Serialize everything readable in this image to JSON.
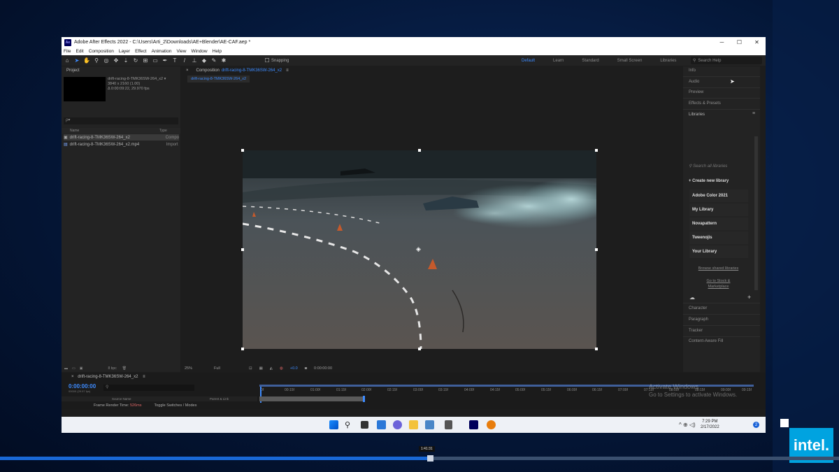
{
  "window": {
    "title": "Adobe After Effects 2022 - C:\\Users\\Arti_2\\Downloads\\AE+Blender\\AE-CAF.aep *",
    "app_abbr": "Ae"
  },
  "controls": {
    "minimize": "─",
    "maximize": "☐",
    "close": "✕"
  },
  "menu": [
    "File",
    "Edit",
    "Composition",
    "Layer",
    "Effect",
    "Animation",
    "View",
    "Window",
    "Help"
  ],
  "toolbar": {
    "snapping": "Snapping"
  },
  "workspaces": [
    "Default",
    "Learn",
    "Standard",
    "Small Screen",
    "Libraries"
  ],
  "search_help": "Search Help",
  "project": {
    "title": "Project",
    "item_name": "drift-racing-8-TMK36SW-264_x2 ▾",
    "item_res": "3840 x 2160 (1.00)",
    "item_dur": "Δ 0:00:09:22, 29.970 fps",
    "search_placeholder": "ρ▾",
    "col_name": "Name",
    "col_type": "Type",
    "rows": [
      {
        "name": "drift-racing-8-TMK36SW-264_x2",
        "type": "Compo"
      },
      {
        "name": "drift-racing-8-TMK36SW-264_x2.mp4",
        "type": "Import"
      }
    ],
    "bpc": "8 bpc"
  },
  "composition": {
    "label": "Composition",
    "name": "drift-racing-8-TMK36SW-264_x2",
    "subtab": "drift-racing-8-TMK36SW-264_x2",
    "zoom": "25%",
    "resolution": "Full",
    "exposure": "+0.0",
    "timecode": "0:00:00:00"
  },
  "right_panel": {
    "items_top": [
      "Info",
      "Audio",
      "Preview",
      "Effects & Presets",
      "Libraries"
    ],
    "library_search": "Search all libraries",
    "create_library": "+ Create new library",
    "libraries": [
      "Adobe Color 2021",
      "My Library",
      "Novapattern",
      "Tweenojis",
      "Your Library"
    ],
    "links": [
      "Browse shared libraries",
      "Go to Stock & Marketplace"
    ],
    "items_bottom": [
      "Character",
      "Paragraph",
      "Tracker",
      "Content-Aware Fill"
    ]
  },
  "timeline": {
    "tab": "drift-racing-8-TMK36SW-264_x2",
    "time": "0:00:00:00",
    "fps": "00000 (29.97 fps)",
    "ruler": [
      "0f",
      "00:15f",
      "01:00f",
      "01:15f",
      "02:00f",
      "02:15f",
      "03:00f",
      "03:15f",
      "04:00f",
      "04:15f",
      "05:00f",
      "05:15f",
      "06:00f",
      "06:15f",
      "07:00f",
      "07:15f",
      "08:00f",
      "08:15f",
      "09:00f",
      "09:15f"
    ],
    "col_source": "Source Name",
    "col_parent": "Parent & Link",
    "render_label": "Frame Render Time",
    "render_value": "526ms",
    "toggle": "Toggle Switches / Modes"
  },
  "watermark": {
    "line1": "Activate Windows",
    "line2": "Go to Settings to activate Windows."
  },
  "taskbar": {
    "time": "7:29 PM",
    "date": "2/17/2022",
    "notifications": "2",
    "tray": "^ ⊕ ◁)"
  },
  "player": {
    "tooltip": "1:41:31",
    "progress": 0.51,
    "brand": "intel."
  }
}
